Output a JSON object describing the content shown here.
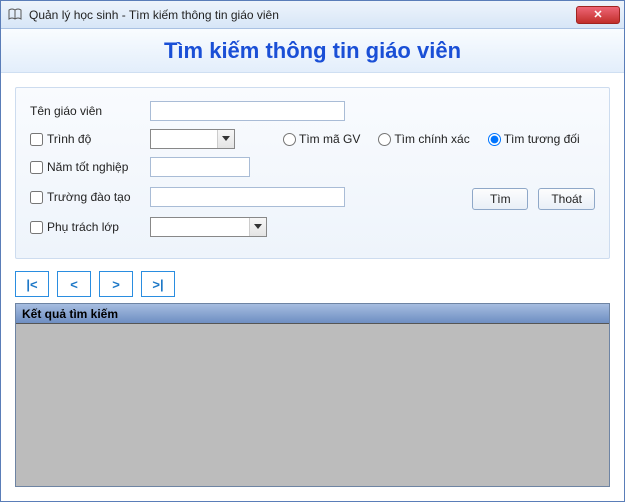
{
  "window": {
    "title": "Quản lý học sinh - Tìm kiếm thông tin giáo viên",
    "close_glyph": "✕"
  },
  "header": {
    "main_title": "Tìm kiếm thông tin giáo viên"
  },
  "form": {
    "teacher_name_label": "Tên giáo viên",
    "teacher_name_value": "",
    "degree_label": "Trình độ",
    "degree_value": "",
    "grad_year_label": "Năm tốt nghiệp",
    "grad_year_value": "",
    "school_label": "Trường đào tạo",
    "school_value": "",
    "class_label": "Phụ trách lớp",
    "class_value": "",
    "radio_search_code": "Tìm mã GV",
    "radio_search_exact": "Tìm chính xác",
    "radio_search_approx": "Tìm tương đối",
    "search_btn": "Tìm",
    "exit_btn": "Thoát"
  },
  "nav": {
    "first": "|<",
    "prev": "<",
    "next": ">",
    "last": ">|"
  },
  "results": {
    "header": "Kết quả tìm kiếm"
  }
}
